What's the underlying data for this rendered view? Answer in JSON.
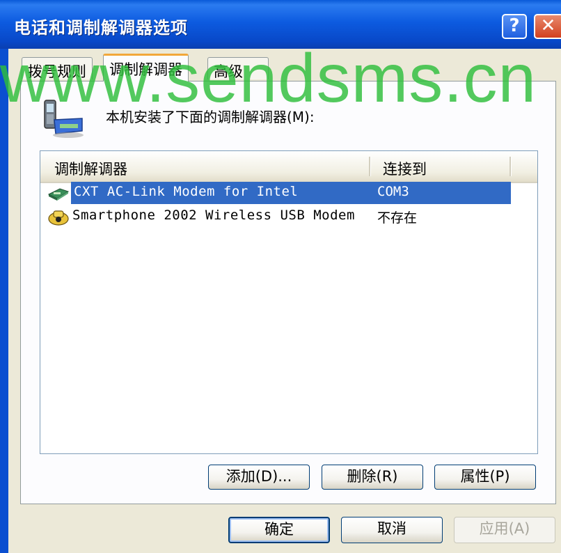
{
  "window": {
    "title": "电话和调制解调器选项"
  },
  "titlebar": {
    "help_label": "?",
    "close_label": "✕"
  },
  "tabs": [
    {
      "label": "拨号规则",
      "active": false
    },
    {
      "label": "调制解调器",
      "active": true
    },
    {
      "label": "高级",
      "active": false
    }
  ],
  "panel": {
    "install_label": "本机安装了下面的调制解调器(M):"
  },
  "list": {
    "columns": [
      "调制解调器",
      "连接到"
    ],
    "rows": [
      {
        "name": "CXT AC-Link Modem for Intel",
        "port": "COM3",
        "icon": "modem-icon",
        "selected": true
      },
      {
        "name": "Smartphone 2002 Wireless USB Modem",
        "port": "不存在",
        "icon": "phone-modem-icon",
        "selected": false
      }
    ]
  },
  "panel_buttons": {
    "add": "添加(D)...",
    "delete": "删除(R)",
    "properties": "属性(P)"
  },
  "dialog_buttons": {
    "ok": "确定",
    "cancel": "取消",
    "apply": "应用(A)"
  },
  "watermark": "www.sendsms.cn",
  "colors": {
    "selection": "#316ac5",
    "titlebar": "#0a5ad8",
    "watermark": "#2fbf3c"
  }
}
